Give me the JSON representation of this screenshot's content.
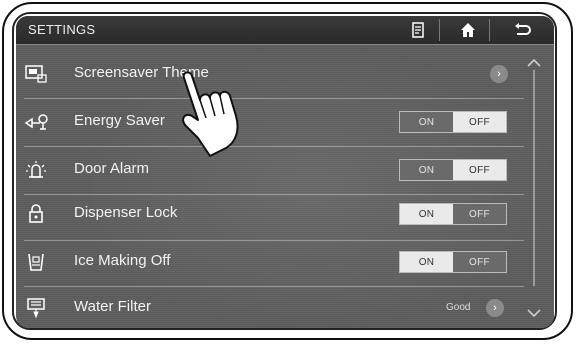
{
  "header": {
    "title": "SETTINGS"
  },
  "icons": {
    "notes": "memo-icon",
    "home": "home-icon",
    "back": "back-arrow-icon"
  },
  "rows": [
    {
      "label": "Screensaver Theme",
      "icon": "screensaver-icon",
      "control": "chevron"
    },
    {
      "label": "Energy Saver",
      "icon": "energy-saver-icon",
      "control": "toggle",
      "on": "ON",
      "off": "OFF",
      "state": "OFF"
    },
    {
      "label": "Door Alarm",
      "icon": "door-alarm-icon",
      "control": "toggle",
      "on": "ON",
      "off": "OFF",
      "state": "OFF"
    },
    {
      "label": "Dispenser Lock",
      "icon": "lock-icon",
      "control": "toggle",
      "on": "ON",
      "off": "OFF",
      "state": "ON"
    },
    {
      "label": "Ice Making Off",
      "icon": "ice-icon",
      "control": "toggle",
      "on": "ON",
      "off": "OFF",
      "state": "ON"
    },
    {
      "label": "Water Filter",
      "icon": "water-filter-icon",
      "control": "chevron",
      "status": "Good"
    }
  ]
}
